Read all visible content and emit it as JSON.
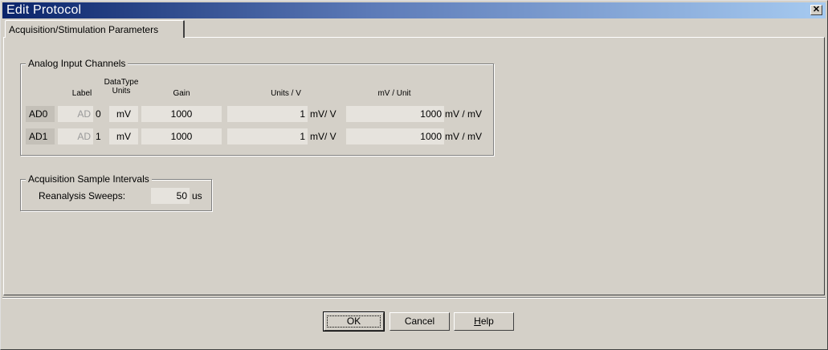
{
  "window": {
    "title": "Edit Protocol",
    "close_symbol": "✕"
  },
  "tabs": [
    {
      "label": "Acquisition/Stimulation Parameters",
      "active": true
    }
  ],
  "analog_input": {
    "group_title": "Analog Input Channels",
    "headers": {
      "label": "Label",
      "datatype_units_line1": "DataType",
      "datatype_units_line2": "Units",
      "gain": "Gain",
      "units_per_v": "Units / V",
      "mv_per_unit": "mV / Unit"
    },
    "rows": [
      {
        "channel": "AD0",
        "label_prefix": "AD",
        "label_num": "0",
        "units": "mV",
        "gain": "1000",
        "units_per_v": "1",
        "units_per_v_unit": "mV/ V",
        "mv_per_unit": "1000",
        "mv_per_unit_unit": "mV / mV"
      },
      {
        "channel": "AD1",
        "label_prefix": "AD",
        "label_num": "1",
        "units": "mV",
        "gain": "1000",
        "units_per_v": "1",
        "units_per_v_unit": "mV/ V",
        "mv_per_unit": "1000",
        "mv_per_unit_unit": "mV / mV"
      }
    ]
  },
  "sample_intervals": {
    "group_title": "Acquisition Sample Intervals",
    "reanalysis_label": "Reanalysis Sweeps:",
    "reanalysis_value": "50",
    "reanalysis_unit": "us"
  },
  "buttons": {
    "ok": "OK",
    "cancel": "Cancel",
    "help_underlined": "H",
    "help_rest": "elp"
  }
}
